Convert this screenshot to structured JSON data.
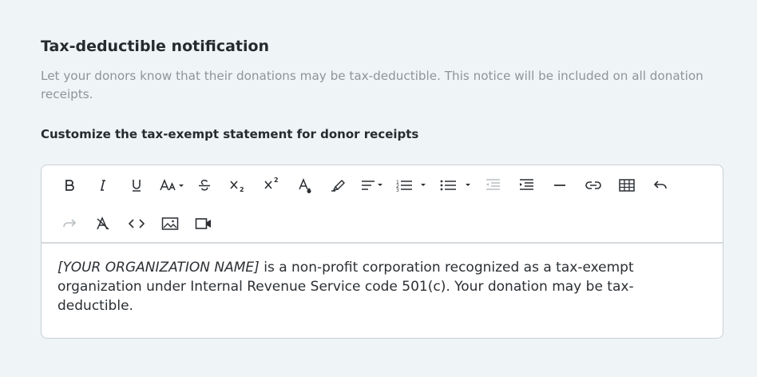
{
  "section": {
    "title": "Tax-deductible notification",
    "description": "Let your donors know that their donations may be tax-deductible. This notice will be included on all donation receipts."
  },
  "statement": {
    "label": "Customize the tax-exempt statement for donor receipts"
  },
  "toolbar": {
    "row1": [
      "bold-icon",
      "italic-icon",
      "underline-icon",
      "font-size-icon",
      "strikethrough-icon",
      "subscript-icon",
      "superscript-icon",
      "font-color-icon",
      "highlight-icon",
      "align-icon",
      "ordered-list-icon",
      "bullet-list-icon",
      "outdent-icon",
      "indent-icon",
      "horizontal-rule-icon",
      "link-icon",
      "table-icon",
      "undo-icon"
    ],
    "row2": [
      "redo-icon",
      "clear-format-icon",
      "code-view-icon",
      "insert-image-icon",
      "insert-video-icon"
    ]
  },
  "editor": {
    "placeholder_name": "[YOUR ORGANIZATION NAME]",
    "body_text": " is a non-profit corporation recognized as a tax-exempt organization under Internal Revenue Service code 501(c).  Your donation may be tax-deductible."
  }
}
